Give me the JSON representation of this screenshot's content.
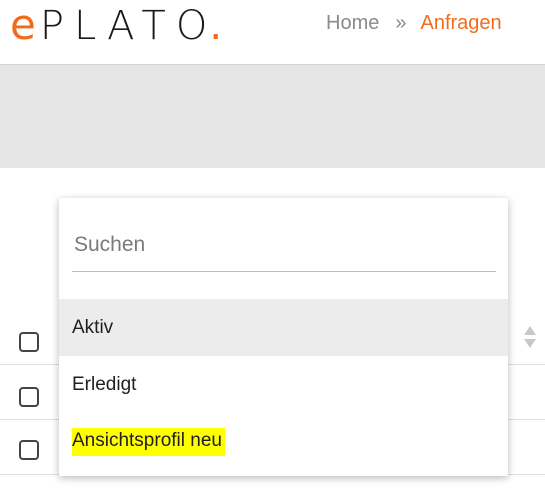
{
  "header": {
    "logo": {
      "e": "e",
      "main": "PLATO",
      "dot": "."
    },
    "breadcrumb": {
      "home": "Home",
      "separator": "»",
      "current": "Anfragen"
    }
  },
  "colors": {
    "accent": "#f26b1d",
    "band": "#e6e6e6",
    "highlight": "#ffff00"
  },
  "dropdown": {
    "search_placeholder": "Suchen",
    "options": [
      {
        "label": "Aktiv",
        "state": "hovered"
      },
      {
        "label": "Erledigt",
        "state": "normal"
      },
      {
        "label": "Ansichtsprofil neu",
        "state": "highlighted"
      }
    ]
  },
  "table": {
    "icons": {
      "sort": "sort-updown-icon",
      "checkbox": "checkbox-icon"
    }
  }
}
